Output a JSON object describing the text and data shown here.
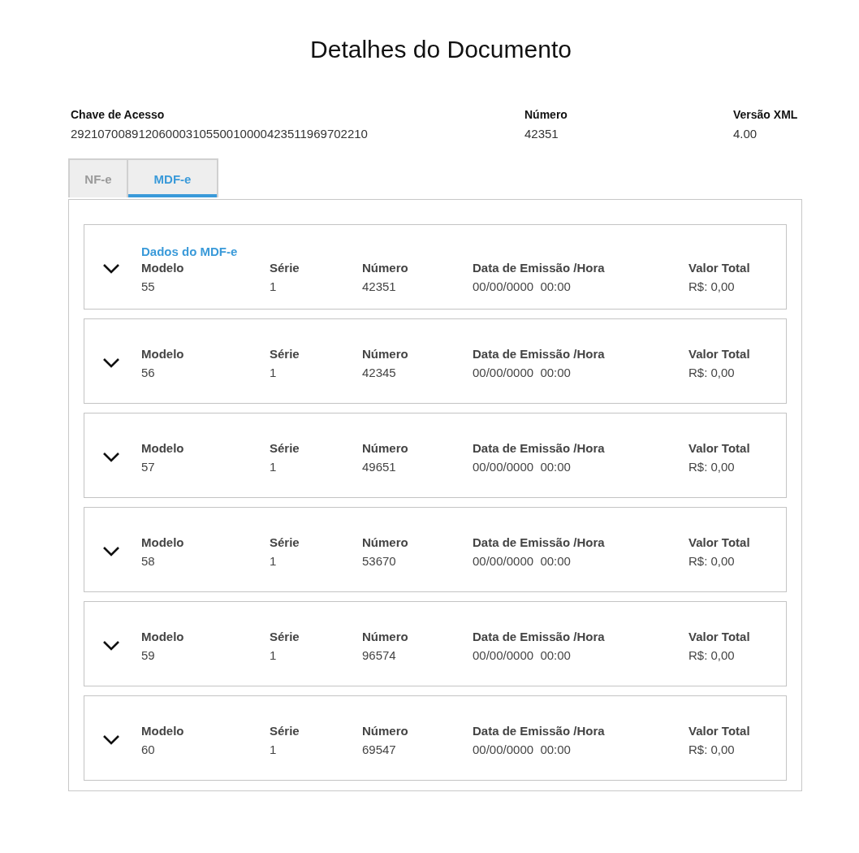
{
  "title": "Detalhes do Documento",
  "meta": [
    {
      "label": "Chave de Acesso",
      "value": "29210700891206000310550010000423511969702210"
    },
    {
      "label": "Número",
      "value": "42351"
    },
    {
      "label": "Versão XML",
      "value": "4.00"
    }
  ],
  "tabs": [
    {
      "label": "NF-e",
      "selected": false
    },
    {
      "label": "MDF-e",
      "selected": true
    }
  ],
  "cards": [
    {
      "title": "Dados do MDF-e",
      "fields": [
        {
          "label": "Modelo",
          "value": "55"
        },
        {
          "label": "Série",
          "value": "1"
        },
        {
          "label": "Número",
          "value": "42351"
        },
        {
          "label": "Data de Emissão /Hora",
          "value": "00/00/0000  00:00"
        },
        {
          "label": "Valor Total",
          "value": "R$: 0,00"
        }
      ]
    },
    {
      "fields": [
        {
          "label": "Modelo",
          "value": "56"
        },
        {
          "label": "Série",
          "value": "1"
        },
        {
          "label": "Número",
          "value": "42345"
        },
        {
          "label": "Data de Emissão /Hora",
          "value": "00/00/0000  00:00"
        },
        {
          "label": "Valor Total",
          "value": "R$: 0,00"
        }
      ]
    },
    {
      "fields": [
        {
          "label": "Modelo",
          "value": "57"
        },
        {
          "label": "Série",
          "value": "1"
        },
        {
          "label": "Número",
          "value": "49651"
        },
        {
          "label": "Data de Emissão /Hora",
          "value": "00/00/0000  00:00"
        },
        {
          "label": "Valor Total",
          "value": "R$: 0,00"
        }
      ]
    },
    {
      "fields": [
        {
          "label": "Modelo",
          "value": "58"
        },
        {
          "label": "Série",
          "value": "1"
        },
        {
          "label": "Número",
          "value": "53670"
        },
        {
          "label": "Data de Emissão /Hora",
          "value": "00/00/0000  00:00"
        },
        {
          "label": "Valor Total",
          "value": "R$: 0,00"
        }
      ]
    },
    {
      "fields": [
        {
          "label": "Modelo",
          "value": "59"
        },
        {
          "label": "Série",
          "value": "1"
        },
        {
          "label": "Número",
          "value": "96574"
        },
        {
          "label": "Data de Emissão /Hora",
          "value": "00/00/0000  00:00"
        },
        {
          "label": "Valor Total",
          "value": "R$: 0,00"
        }
      ]
    },
    {
      "fields": [
        {
          "label": "Modelo",
          "value": "60"
        },
        {
          "label": "Série",
          "value": "1"
        },
        {
          "label": "Número",
          "value": "69547"
        },
        {
          "label": "Data de Emissão /Hora",
          "value": "00/00/0000  00:00"
        },
        {
          "label": "Valor Total",
          "value": "R$: 0,00"
        }
      ]
    }
  ]
}
